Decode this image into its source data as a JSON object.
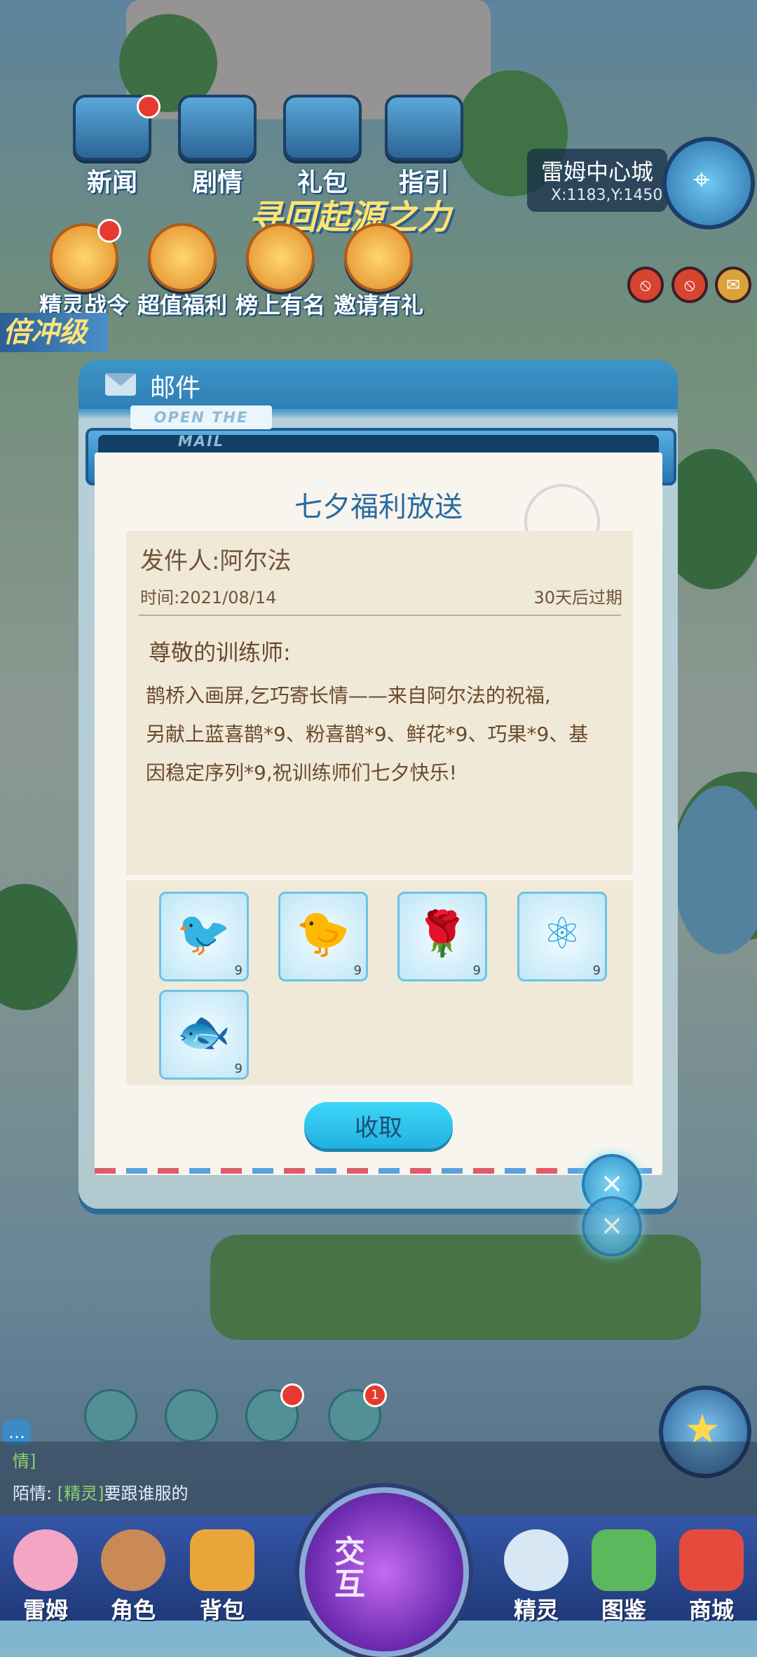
{
  "top_nav": [
    {
      "label": "新闻",
      "badge": true
    },
    {
      "label": "剧情",
      "badge": false
    },
    {
      "label": "礼包",
      "badge": false
    },
    {
      "label": "指引",
      "badge": false
    }
  ],
  "activities": [
    {
      "label": "精灵战令",
      "badge": true
    },
    {
      "label": "超值福利",
      "badge": false
    },
    {
      "label": "榜上有名",
      "badge": false
    },
    {
      "label": "邀请有礼",
      "badge": false
    }
  ],
  "slogan": "寻回起源之力",
  "double_level": "倍冲级",
  "location": {
    "city": "雷姆中心城",
    "coords": "X:1183,Y:1450"
  },
  "mail": {
    "header_title": "邮件",
    "tag": "OPEN THE MAIL",
    "subject": "七夕福利放送",
    "sender": "发件人:阿尔法",
    "date": "时间:2021/08/14",
    "expire": "30天后过期",
    "greeting": "尊敬的训练师:",
    "body_lines": [
      "鹊桥入画屏,乞巧寄长情——来自阿尔法的祝福,",
      "另献上蓝喜鹊*9、粉喜鹊*9、鲜花*9、巧果*9、基",
      "因稳定序列*9,祝训练师们七夕快乐!"
    ],
    "attachments": [
      {
        "icon": "blue-magpie-icon",
        "glyph": "🐦",
        "qty": "9"
      },
      {
        "icon": "pink-magpie-icon",
        "glyph": "🐤",
        "qty": "9"
      },
      {
        "icon": "rose-icon",
        "glyph": "🌹",
        "qty": "9"
      },
      {
        "icon": "gene-sequence-icon",
        "glyph": "⚛",
        "qty": "9"
      },
      {
        "icon": "qiaoguo-pastry-icon",
        "glyph": "🐟",
        "qty": "9"
      }
    ],
    "collect_label": "收取",
    "close_glyph": "×"
  },
  "bottom_badge_count": "1",
  "chat": {
    "lines": [
      {
        "prefix": "情]",
        "name": "",
        "text": ""
      },
      {
        "prefix": "陌情:",
        "name": "[精灵]",
        "text": "要跟谁服的"
      }
    ]
  },
  "bottom_nav": [
    {
      "label": "雷姆"
    },
    {
      "label": "角色"
    },
    {
      "label": "背包"
    },
    {
      "label": "精灵"
    },
    {
      "label": "图鉴"
    },
    {
      "label": "商城"
    }
  ],
  "interact_label": "交互",
  "colors": {
    "accent": "#2a6aa0",
    "button": "#20b2e2",
    "paper": "#f7f5ee",
    "panel": "#f1e9d8"
  }
}
